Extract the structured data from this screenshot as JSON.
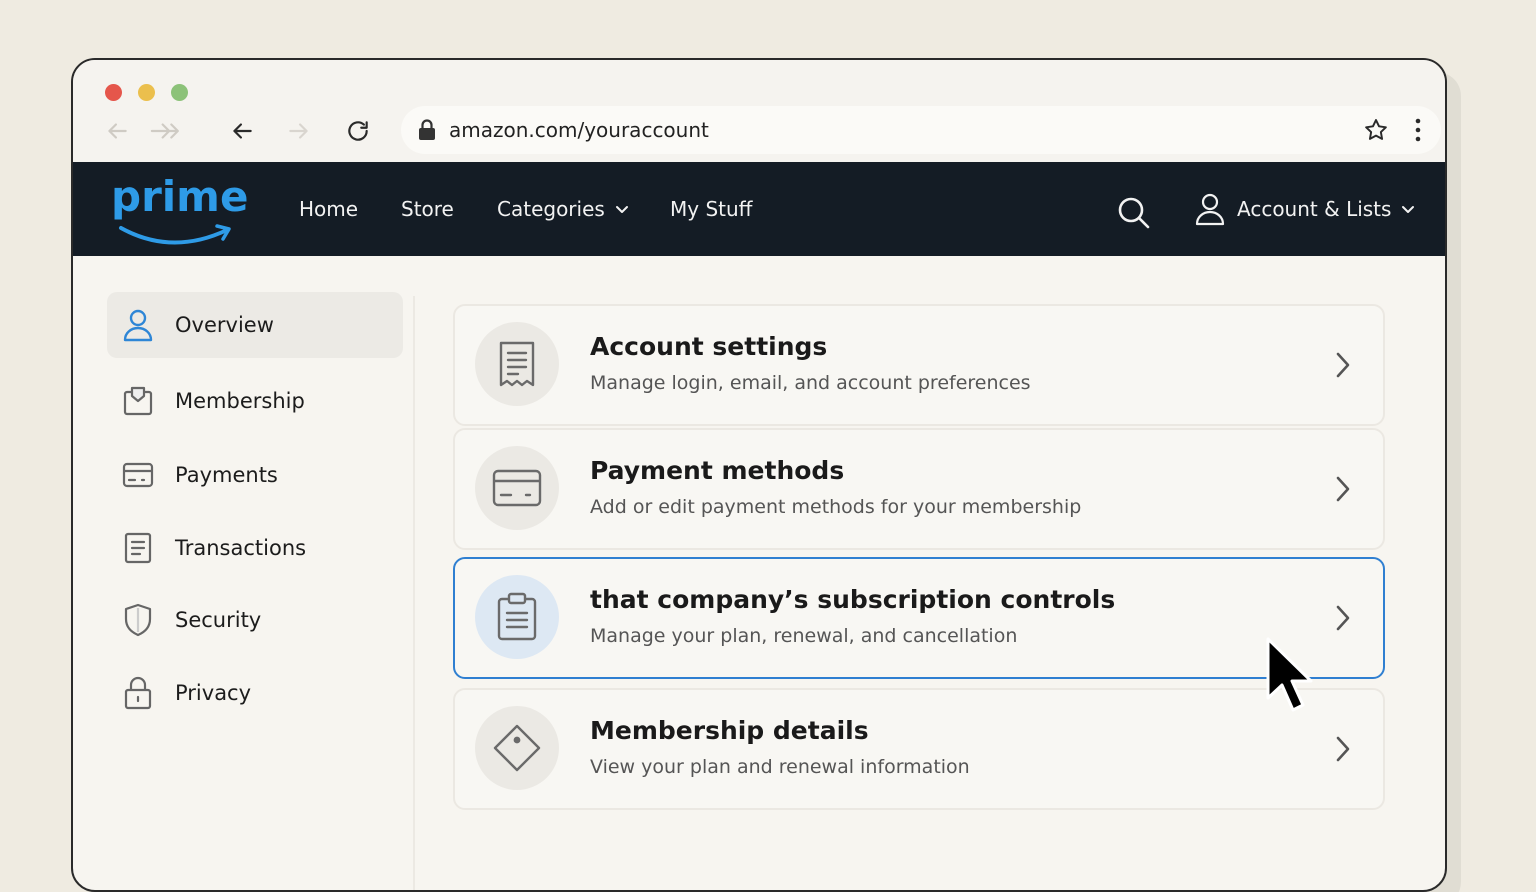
{
  "browser": {
    "url": "amazon.com/youraccount"
  },
  "header": {
    "logo_text": "prime",
    "nav": [
      "Home",
      "Store",
      "Categories",
      "My Stuff"
    ],
    "account_label": "Account & Lists"
  },
  "sidebar": {
    "items": [
      {
        "label": "Overview",
        "icon": "user-icon",
        "active": true
      },
      {
        "label": "Membership",
        "icon": "membership-box-icon"
      },
      {
        "label": "Payments",
        "icon": "credit-card-icon"
      },
      {
        "label": "Transactions",
        "icon": "document-icon"
      },
      {
        "label": "Security",
        "icon": "shield-icon"
      },
      {
        "label": "Privacy",
        "icon": "lock-icon"
      }
    ]
  },
  "cards": [
    {
      "title": "Account settings",
      "desc": "Manage login, email, and account preferences",
      "icon": "receipt-icon"
    },
    {
      "title": "Payment methods",
      "desc": "Add or edit payment methods for your membership",
      "icon": "credit-card-icon"
    },
    {
      "title": "that company’s subscription controls",
      "desc": "Manage your plan, renewal, and cancellation",
      "icon": "clipboard-icon",
      "highlighted": true
    },
    {
      "title": "Membership details",
      "desc": "View your plan and renewal information",
      "icon": "tag-icon"
    }
  ],
  "colors": {
    "header_bg": "#141c25",
    "brand_blue": "#2e9be7",
    "highlight_border": "#2f7fd1"
  }
}
